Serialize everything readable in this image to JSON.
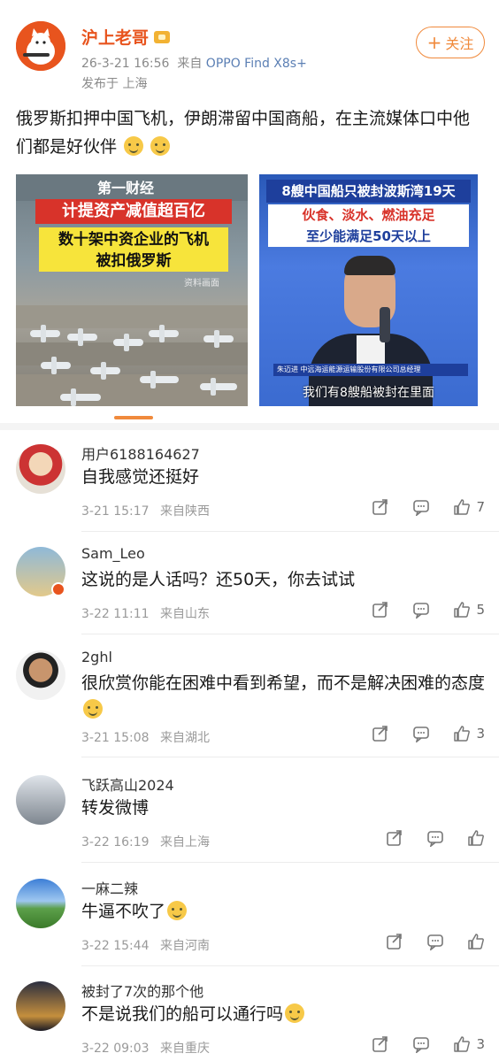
{
  "post": {
    "author": "沪上老哥",
    "follow_label": "关注",
    "time": "26-3-21 16:56",
    "source_prefix": "来自",
    "device": "OPPO Find X8s+",
    "location": "发布于 上海",
    "text": "俄罗斯扣押中国飞机，伊朗滞留中国商船，在主流媒体口中他们都是好伙伴",
    "image1": {
      "logo": "第一财经",
      "banner": "计提资产减值超百亿",
      "headline_line1": "数十架中资企业的飞机",
      "headline_line2": "被扣俄罗斯",
      "tag": "资料画面"
    },
    "image2": {
      "title": "8艘中国船只被封波斯湾19天",
      "line1": "伙食、淡水、燃油充足",
      "line2": "至少能满足50天以上",
      "caption_name": "朱迈进  中远海运能源运输股份有限公司总经理",
      "subtitle": "我们有8艘船被封在里面"
    }
  },
  "comments": [
    {
      "name": "用户6188164627",
      "text": "自我感觉还挺好",
      "time": "3-21 15:17",
      "from": "来自陕西",
      "likes": "7"
    },
    {
      "name": "Sam_Leo",
      "text": "这说的是人话吗？还50天，你去试试",
      "time": "3-22 11:11",
      "from": "来自山东",
      "likes": "5"
    },
    {
      "name": "2ghl",
      "text": "很欣赏你能在困难中看到希望，而不是解决困难的态度",
      "time": "3-21 15:08",
      "from": "来自湖北",
      "likes": "3"
    },
    {
      "name": "飞跃高山2024",
      "text": "转发微博",
      "time": "3-22 16:19",
      "from": "来自上海",
      "likes": ""
    },
    {
      "name": "一麻二辣",
      "text": "牛逼不吹了",
      "time": "3-22 15:44",
      "from": "来自河南",
      "likes": ""
    },
    {
      "name": "被封了7次的那个他",
      "text": "不是说我们的船可以通行吗",
      "time": "3-22 09:03",
      "from": "来自重庆",
      "likes": "3"
    }
  ],
  "colors": {
    "accent": "#f08a3c",
    "author": "#e8541e",
    "device_link": "#5b7fb4"
  }
}
